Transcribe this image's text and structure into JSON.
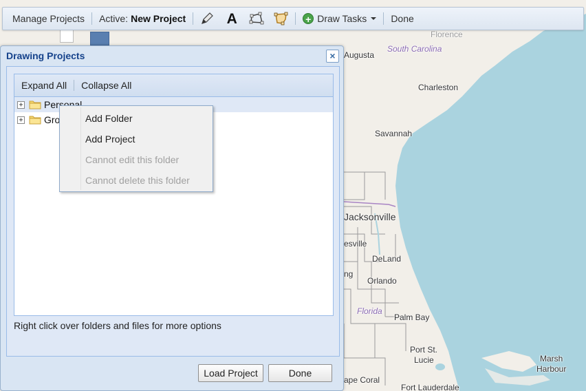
{
  "toolbar": {
    "manage_projects": "Manage Projects",
    "active_label": "Active:",
    "active_project": "New Project",
    "tools": [
      "pencil-icon",
      "text-icon",
      "polygon-icon",
      "freehand-icon"
    ],
    "text_tool_glyph": "A",
    "draw_tasks_label": "Draw Tasks",
    "done_label": "Done"
  },
  "dialog": {
    "title": "Drawing Projects",
    "close_glyph": "×",
    "tree_toolbar": {
      "expand_all": "Expand All",
      "collapse_all": "Collapse All"
    },
    "tree": [
      {
        "label": "Personal",
        "selected": true
      },
      {
        "label": "Gro",
        "selected": false
      }
    ],
    "hint": "Right click over folders and files for more options",
    "buttons": {
      "load": "Load Project",
      "done": "Done"
    }
  },
  "context_menu": {
    "items": [
      {
        "label": "Add Folder",
        "disabled": false
      },
      {
        "label": "Add Project",
        "disabled": false
      },
      {
        "label": "Cannot edit this folder",
        "disabled": true
      },
      {
        "label": "Cannot delete this folder",
        "disabled": true
      }
    ]
  },
  "map": {
    "labels": {
      "florence": "Florence",
      "augusta": "Augusta",
      "south_carolina": "South Carolina",
      "charleston": "Charleston",
      "savannah": "Savannah",
      "jacksonville": "Jacksonville",
      "gainesville": "esville",
      "deland": "DeLand",
      "ocala": "ng",
      "orlando": "Orlando",
      "florida": "Florida",
      "palm_bay": "Palm Bay",
      "port_st_lucie_1": "Port St.",
      "port_st_lucie_2": "Lucie",
      "cape_coral": "ape Coral",
      "fort_lauderdale": "Fort Lauderdale",
      "marsh_harbour_1": "Marsh",
      "marsh_harbour_2": "Harbour"
    },
    "colors": {
      "water": "#aad3df",
      "land": "#f2efe9",
      "border": "#8a8a8a"
    }
  }
}
